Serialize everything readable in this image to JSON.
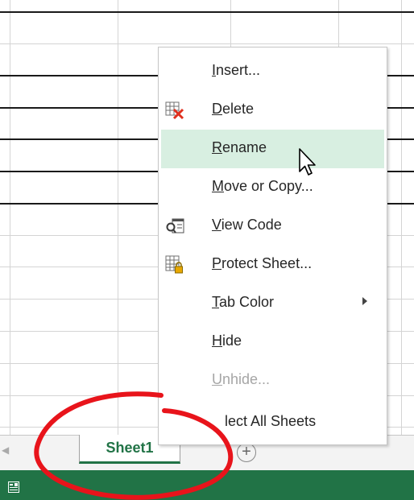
{
  "sheet_tab": {
    "label": "Sheet1"
  },
  "add_sheet": {
    "symbol": "+"
  },
  "tab_scroll": {
    "symbol": "◀"
  },
  "context_menu": {
    "items": [
      {
        "label_pre": "",
        "label_ul": "I",
        "label_post": "nsert...",
        "icon": "",
        "disabled": false,
        "highlighted": false,
        "submenu": false
      },
      {
        "label_pre": "",
        "label_ul": "D",
        "label_post": "elete",
        "icon": "delete-sheet-icon",
        "disabled": false,
        "highlighted": false,
        "submenu": false
      },
      {
        "label_pre": "",
        "label_ul": "R",
        "label_post": "ename",
        "icon": "",
        "disabled": false,
        "highlighted": true,
        "submenu": false
      },
      {
        "label_pre": "",
        "label_ul": "M",
        "label_post": "ove or Copy...",
        "icon": "",
        "disabled": false,
        "highlighted": false,
        "submenu": false
      },
      {
        "label_pre": "",
        "label_ul": "V",
        "label_post": "iew Code",
        "icon": "view-code-icon",
        "disabled": false,
        "highlighted": false,
        "submenu": false
      },
      {
        "label_pre": "",
        "label_ul": "P",
        "label_post": "rotect Sheet...",
        "icon": "protect-sheet-icon",
        "disabled": false,
        "highlighted": false,
        "submenu": false
      },
      {
        "label_pre": "",
        "label_ul": "T",
        "label_post": "ab Color",
        "icon": "",
        "disabled": false,
        "highlighted": false,
        "submenu": true
      },
      {
        "label_pre": "",
        "label_ul": "H",
        "label_post": "ide",
        "icon": "",
        "disabled": false,
        "highlighted": false,
        "submenu": false
      },
      {
        "label_pre": "",
        "label_ul": "U",
        "label_post": "nhide...",
        "icon": "",
        "disabled": true,
        "highlighted": false,
        "submenu": false
      },
      {
        "label_pre": "",
        "label_ul": "",
        "label_post": "lect All Sheets",
        "icon": "",
        "disabled": false,
        "highlighted": false,
        "submenu": false
      }
    ]
  },
  "colors": {
    "excel_green": "#217346",
    "highlight": "#d8efe1",
    "annotation_red": "#e8141b"
  }
}
